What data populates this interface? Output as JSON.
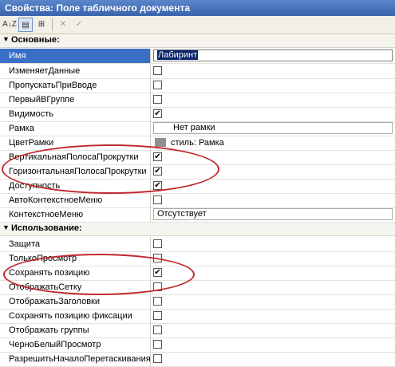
{
  "window": {
    "title": "Свойства: Поле табличного документа"
  },
  "toolbar": {
    "buttons": [
      {
        "name": "sort-alpha-icon",
        "glyph": "A↓Z"
      },
      {
        "name": "categorize-icon",
        "glyph": "▤"
      },
      {
        "name": "filter-icon",
        "glyph": "⊞"
      },
      {
        "name": "cancel-icon",
        "glyph": "✕"
      },
      {
        "name": "apply-icon",
        "glyph": "✓"
      }
    ]
  },
  "sections": {
    "main": {
      "label": "Основные:"
    },
    "usage": {
      "label": "Использование:"
    }
  },
  "props": {
    "imya": {
      "name": "Имя",
      "value": "Лабиринт"
    },
    "izmenyaet": {
      "name": "ИзменяетДанные",
      "checked": false
    },
    "propuskat": {
      "name": "ПропускатьПриВводе",
      "checked": false
    },
    "perviy": {
      "name": "ПервыйВГруппе",
      "checked": false
    },
    "vidimost": {
      "name": "Видимость",
      "checked": true
    },
    "ramka": {
      "name": "Рамка",
      "value": "Нет рамки"
    },
    "tsvetramki": {
      "name": "ЦветРамки",
      "value": "стиль: Рамка",
      "color": "#8e8e8e"
    },
    "vertikal": {
      "name": "ВертикальнаяПолосаПрокрутки",
      "checked": true
    },
    "gorizont": {
      "name": "ГоризонтальнаяПолосаПрокрутки",
      "checked": true
    },
    "dostupnost": {
      "name": "Доступность",
      "checked": true
    },
    "avtokontekst": {
      "name": "АвтоКонтекстноеМеню",
      "checked": false
    },
    "kontekst": {
      "name": "КонтекстноеМеню",
      "value": "Отсутствует"
    },
    "zashita": {
      "name": "Защита",
      "checked": false
    },
    "tolkoprosmotr": {
      "name": "ТолькоПросмотр",
      "checked": false
    },
    "sohranyat": {
      "name": "Сохранять позицию",
      "checked": true
    },
    "setku": {
      "name": "ОтображатьСетку",
      "checked": false
    },
    "zagolovki": {
      "name": "ОтображатьЗаголовки",
      "checked": false
    },
    "fiksacii": {
      "name": "Сохранять позицию фиксации",
      "checked": false
    },
    "gruppy": {
      "name": "Отображать группы",
      "checked": false
    },
    "chernobeliy": {
      "name": "ЧерноБелыйПросмотр",
      "checked": false
    },
    "razreshit": {
      "name": "РазрешитьНачалоПеретаскивания",
      "checked": false
    }
  },
  "annotations": {
    "color": "#c1272d"
  }
}
